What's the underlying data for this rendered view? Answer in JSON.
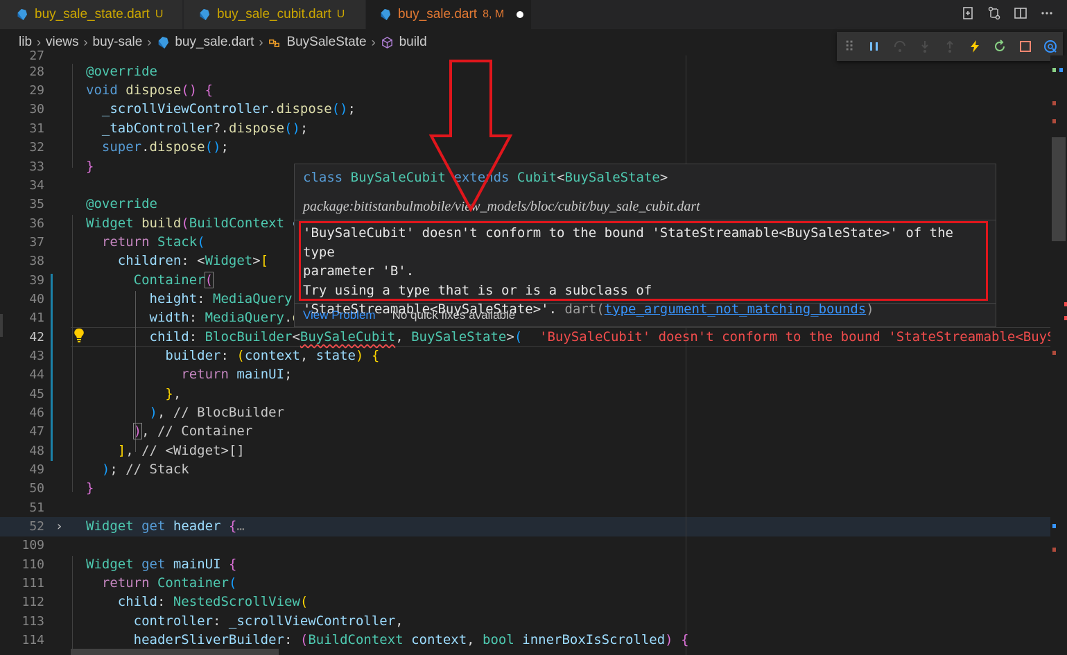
{
  "tabs": [
    {
      "name": "buy_sale_state.dart",
      "status": "U"
    },
    {
      "name": "buy_sale_cubit.dart",
      "status": "U"
    },
    {
      "name": "buy_sale.dart",
      "status": "8, M"
    }
  ],
  "breadcrumb": [
    "lib",
    "views",
    "buy-sale",
    "buy_sale.dart",
    "BuySaleState",
    "build"
  ],
  "colors": {
    "accent": "#007acc",
    "error": "#f14c4c",
    "annotation_red": "#e0161c",
    "modified": "#e37933"
  },
  "lines": [
    {
      "n": "27"
    },
    {
      "n": "28",
      "t": "@override"
    },
    {
      "n": "29",
      "t": "void dispose() {"
    },
    {
      "n": "30",
      "t": "  _scrollViewController.dispose();"
    },
    {
      "n": "31",
      "t": "  _tabController?.dispose();"
    },
    {
      "n": "32",
      "t": "  super.dispose();"
    },
    {
      "n": "33",
      "t": "}"
    },
    {
      "n": "34",
      "t": ""
    },
    {
      "n": "35",
      "t": "@override"
    },
    {
      "n": "36",
      "t": "Widget build(BuildContext c"
    },
    {
      "n": "37",
      "t": "  return Stack("
    },
    {
      "n": "38",
      "t": "    children: <Widget>["
    },
    {
      "n": "39",
      "t": "      Container("
    },
    {
      "n": "40",
      "t": "        height: MediaQuery."
    },
    {
      "n": "41",
      "t": "        width: MediaQuery.o"
    },
    {
      "n": "42",
      "t": "        child: BlocBuilder<BuySaleCubit, BuySaleState>("
    },
    {
      "n": "43",
      "t": "          builder: (context, state) {"
    },
    {
      "n": "44",
      "t": "            return mainUI;"
    },
    {
      "n": "45",
      "t": "          },"
    },
    {
      "n": "46",
      "t": "        ), // BlocBuilder"
    },
    {
      "n": "47",
      "t": "      ), // Container"
    },
    {
      "n": "48",
      "t": "    ], // <Widget>[]"
    },
    {
      "n": "49",
      "t": "  ); // Stack"
    },
    {
      "n": "50",
      "t": "}"
    },
    {
      "n": "51",
      "t": ""
    },
    {
      "n": "52",
      "t": "Widget get header {…"
    },
    {
      "n": "109",
      "t": ""
    },
    {
      "n": "110",
      "t": "Widget get mainUI {"
    },
    {
      "n": "111",
      "t": "  return Container("
    },
    {
      "n": "112",
      "t": "    child: NestedScrollView("
    },
    {
      "n": "113",
      "t": "      controller: _scrollViewController,"
    },
    {
      "n": "114",
      "t": "      headerSliverBuilder: (BuildContext context, bool innerBoxIsScrolled) {"
    }
  ],
  "inline_error": "'BuySaleCubit' doesn't conform to the bound 'StateStreamable<BuySaleS",
  "hover": {
    "signature": {
      "kw": "class",
      "name": "BuySaleCubit",
      "ext": "extends",
      "base": "Cubit",
      "lt": "<",
      "arg": "BuySaleState",
      "gt": ">"
    },
    "package": "package:bitistanbulmobile/view_models/bloc/cubit/buy_sale_cubit.dart",
    "message_1": "'BuySaleCubit' doesn't conform to the bound 'StateStreamable<BuySaleState>' of the type",
    "message_2": "parameter 'B'.",
    "message_3": "Try using a type that is or is a subclass of",
    "message_4": "'StateStreamable<BuySaleState>'.",
    "source": "dart",
    "code": "type_argument_not_matching_bounds",
    "view_problem": "View Problem",
    "no_fixes": "No quick fixes available"
  }
}
